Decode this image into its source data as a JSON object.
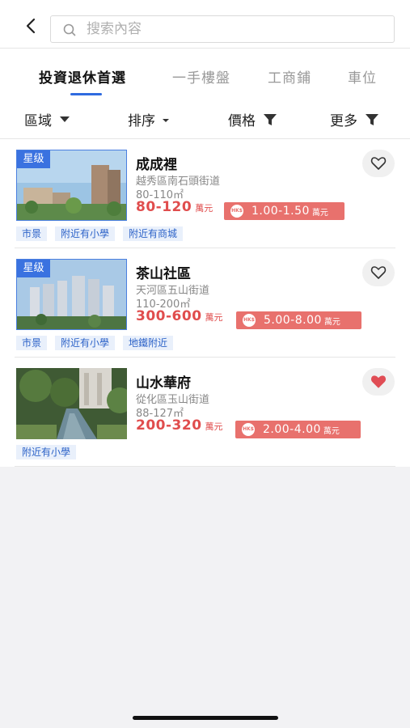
{
  "search": {
    "placeholder": "搜索內容"
  },
  "tabs": [
    {
      "label": "投資退休首選",
      "active": true
    },
    {
      "label": "一手樓盤",
      "active": false
    },
    {
      "label": "工商鋪",
      "active": false
    },
    {
      "label": "車位",
      "active": false
    }
  ],
  "filters": [
    {
      "label": "區域",
      "icon": "caret-down-icon"
    },
    {
      "label": "排序",
      "icon": "caret-down-small-icon"
    },
    {
      "label": "價格",
      "icon": "filter-funnel-icon"
    },
    {
      "label": "更多",
      "icon": "filter-funnel-icon"
    }
  ],
  "listings": [
    {
      "badge": "星级",
      "name": "成成裡",
      "district": "越秀區南石頭街道",
      "area": "80-110㎡",
      "price": "80-120",
      "price_unit": "萬元",
      "budget_icon": "HK$",
      "budget": "1.00-1.50",
      "budget_unit": "萬元",
      "favorited": false,
      "tags": [
        "市景",
        "附近有小學",
        "附近有商城"
      ]
    },
    {
      "badge": "星级",
      "name": "茶山社區",
      "district": "天河區五山街道",
      "area": "110-200㎡",
      "price": "300-600",
      "price_unit": "萬元",
      "budget_icon": "HK$",
      "budget": "5.00-8.00",
      "budget_unit": "萬元",
      "favorited": false,
      "tags": [
        "市景",
        "附近有小學",
        "地鐵附近"
      ]
    },
    {
      "badge": "",
      "name": "山水華府",
      "district": "從化區玉山街道",
      "area": "88-127㎡",
      "price": "200-320",
      "price_unit": "萬元",
      "budget_icon": "HK$",
      "budget": "2.00-4.00",
      "budget_unit": "萬元",
      "favorited": true,
      "tags": [
        "附近有小學"
      ]
    }
  ],
  "colors": {
    "accent": "#2f6be0",
    "price": "#e04d4d",
    "budget_bg": "#e8716d",
    "tag_bg": "#e9f0fb",
    "tag_text": "#2d63c8"
  }
}
